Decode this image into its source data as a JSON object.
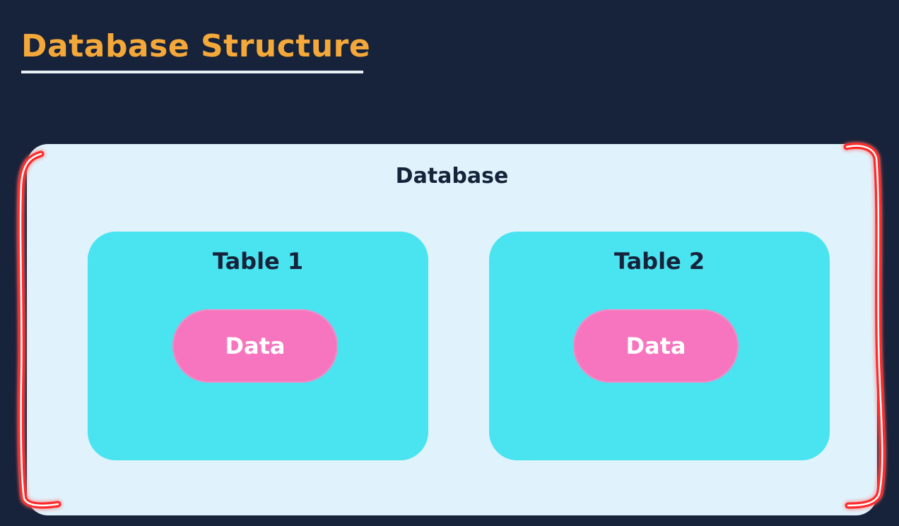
{
  "slide": {
    "title": "Database Structure"
  },
  "diagram": {
    "database_label": "Database",
    "tables": [
      {
        "label": "Table 1",
        "content_label": "Data"
      },
      {
        "label": "Table 2",
        "content_label": "Data"
      }
    ]
  },
  "colors": {
    "background": "#16233a",
    "title": "#f4a83a",
    "database_fill": "#e0f3fc",
    "table_fill": "#4ae3f0",
    "data_fill": "#f774be",
    "annotation_stroke": "#ff2b2b"
  }
}
